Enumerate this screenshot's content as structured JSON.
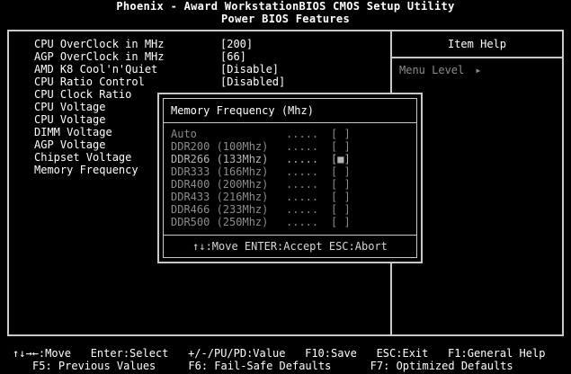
{
  "header": {
    "title": "Phoenix - Award WorkstationBIOS CMOS Setup Utility",
    "subtitle": "Power BIOS Features"
  },
  "settings": [
    {
      "label": "CPU OverClock in MHz",
      "value": "[200]"
    },
    {
      "label": "AGP OverClock in MHz",
      "value": "[66]"
    },
    {
      "label": "AMD K8 Cool'n'Quiet",
      "value": "[Disable]"
    },
    {
      "label": "CPU Ratio Control",
      "value": "[Disabled]"
    },
    {
      "label": "CPU Clock Ratio",
      "value": ""
    },
    {
      "label": "CPU Voltage",
      "value": ""
    },
    {
      "label": "CPU Voltage",
      "value": ""
    },
    {
      "label": "DIMM Voltage",
      "value": ""
    },
    {
      "label": "AGP Voltage",
      "value": ""
    },
    {
      "label": "Chipset Voltage",
      "value": ""
    },
    {
      "label": "Memory Frequency",
      "value": ""
    }
  ],
  "help": {
    "title": "Item Help",
    "menu_level": "Menu Level",
    "menu_level_icon": "right-triangle-icon"
  },
  "popup": {
    "title": "Memory Frequency (Mhz)",
    "options": [
      {
        "label": "Auto",
        "dots": ".....",
        "mark": "[ ]"
      },
      {
        "label": "DDR200 (100Mhz)",
        "dots": ".....",
        "mark": "[ ]"
      },
      {
        "label": "DDR266 (133Mhz)",
        "dots": ".....",
        "mark": "[■]"
      },
      {
        "label": "DDR333 (166Mhz)",
        "dots": ".....",
        "mark": "[ ]"
      },
      {
        "label": "DDR400 (200Mhz)",
        "dots": ".....",
        "mark": "[ ]"
      },
      {
        "label": "DDR433 (216Mhz)",
        "dots": ".....",
        "mark": "[ ]"
      },
      {
        "label": "DDR466 (233Mhz)",
        "dots": ".....",
        "mark": "[ ]"
      },
      {
        "label": "DDR500 (250Mhz)",
        "dots": ".....",
        "mark": "[ ]"
      }
    ],
    "selected_index": 2,
    "footer": "↑↓:Move ENTER:Accept ESC:Abort"
  },
  "keys": {
    "line1": "↑↓→←:Move   Enter:Select   +/-/PU/PD:Value   F10:Save   ESC:Exit   F1:General Help",
    "line2": "F5: Previous Values     F6: Fail-Safe Defaults      F7: Optimized Defaults"
  },
  "colors": {
    "background": "#000000",
    "text": "#ffffff",
    "dim_text": "#8c8c8c",
    "border": "#c8c8c8"
  }
}
